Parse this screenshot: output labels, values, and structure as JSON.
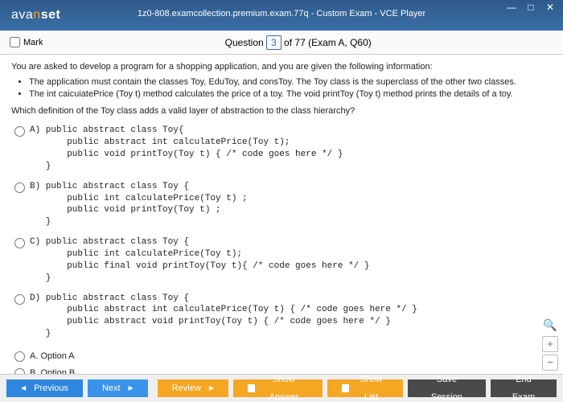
{
  "window": {
    "title": "1z0-808.examcollection.premium.exam.77q - Custom Exam - VCE Player",
    "logo_a": "ava",
    "logo_n": "n",
    "logo_set": "set"
  },
  "header": {
    "mark_label": "Mark",
    "question_word": "Question",
    "current": "3",
    "rest": " of 77 (Exam A, Q60)"
  },
  "body": {
    "intro": "You are asked to develop a program for a shopping application, and you are given the following information:",
    "b1": "The application must contain the classes Toy, EduToy, and consToy. The Toy class is the superclass of the other two classes.",
    "b2": "The int caicuiatePrice (Toy t) method calculates the price of a toy. The void printToy (Toy t) method prints the details of a toy.",
    "stem": "Which definition of the Toy class adds a valid layer of abstraction to the class hierarchy?",
    "optA": "A) public abstract class Toy{\n       public abstract int calculatePrice(Toy t);\n       public void printToy(Toy t) { /* code goes here */ }\n   }",
    "optB": "B) public abstract class Toy {\n       public int calculatePrice(Toy t) ;\n       public void printToy(Toy t) ;\n   }",
    "optC": "C) public abstract class Toy {\n       public int calculatePrice(Toy t);\n       public final void printToy(Toy t){ /* code goes here */ }\n   }",
    "optD": "D) public abstract class Toy {\n       public abstract int calculatePrice(Toy t) { /* code goes here */ }\n       public abstract void printToy(Toy t) { /* code goes here */ }\n   }",
    "ansA": "A.  Option A",
    "ansB": "B.  Option B"
  },
  "footer": {
    "prev": "Previous",
    "next": "Next",
    "review": "Review",
    "show_answer": "Show Answer",
    "show_list": "Show List",
    "save": "Save Session",
    "end": "End Exam"
  }
}
